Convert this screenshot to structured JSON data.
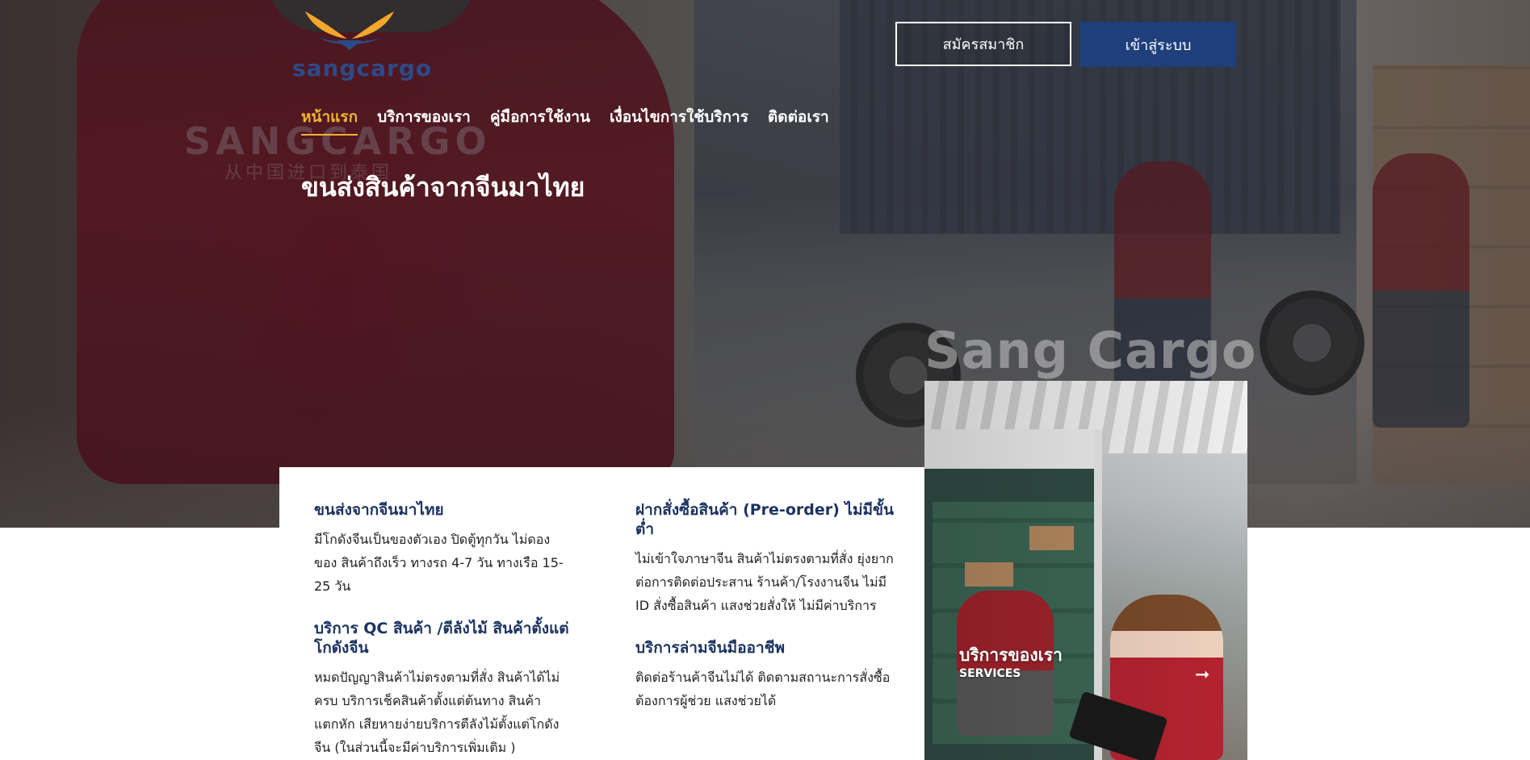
{
  "brand": {
    "logo_text": "sangcargo",
    "big_title": "Sang Cargo"
  },
  "header": {
    "register_label": "สมัครสมาชิก",
    "login_label": "เข้าสู่ระบบ"
  },
  "nav": {
    "items": [
      {
        "label": "หน้าแรก",
        "active": true
      },
      {
        "label": "บริการของเรา",
        "active": false
      },
      {
        "label": "คู่มือการใช้งาน",
        "active": false
      },
      {
        "label": "เงื่อนไขการใช้บริการ",
        "active": false
      },
      {
        "label": "ติดต่อเรา",
        "active": false
      }
    ]
  },
  "hero": {
    "title": "ขนส่งสินค้าจากจีนมาไทย",
    "shirt_print": "SANGCARGO",
    "shirt_print_sub": "从中国进口到泰国"
  },
  "services": {
    "left": [
      {
        "title": "ขนส่งจากจีนมาไทย",
        "desc": "มีโกดังจีนเป็นของตัวเอง ปิดตู้ทุกวัน ไม่ดองของ สินค้าถึงเร็ว ทางรถ 4-7 วัน ทางเรือ 15-25 วัน"
      },
      {
        "title": "บริการ QC สินค้า /ตีลังไม้ สินค้าตั้งแต่โกดังจีน",
        "desc": "หมดปัญญาสินค้าไม่ตรงตามที่สั่ง สินค้าได้ไม่ครบ บริการเช็คสินค้าตั้งแต่ต้นทาง สินค้าแตกหัก เสียหายง่ายบริการตีลังไม้ตั้งแต่โกดังจีน (ในส่วนนี้จะมีค่าบริการเพิ่มเติม )"
      }
    ],
    "right": [
      {
        "title": "ฝากสั่งซื้อสินค้า (Pre-order) ไม่มีขั้นต่ำ",
        "desc": "ไม่เข้าใจภาษาจีน สินค้าไม่ตรงตามที่สั่ง ยุ่งยากต่อการติดต่อประสาน ร้านค้า/โรงงานจีน ไม่มี ID สั่งซื้อสินค้า แสงช่วยสั่งให้ ไม่มีค่าบริการ"
      },
      {
        "title": "บริการล่ามจีนมืออาชีพ",
        "desc": "ติดต่อร้านค้าจีนไม่ได้ ติดตามสถานะการสั่งซื้อ ต้องการผู้ช่วย แสงช่วยได้"
      }
    ]
  },
  "panel": {
    "title": "บริการของเรา",
    "subtitle": "SERVICES",
    "arrow_icon": "arrow-right-icon"
  },
  "colors": {
    "accent": "#f2b233",
    "brand_blue": "#1e3f7a",
    "heading_navy": "#1c3360"
  }
}
